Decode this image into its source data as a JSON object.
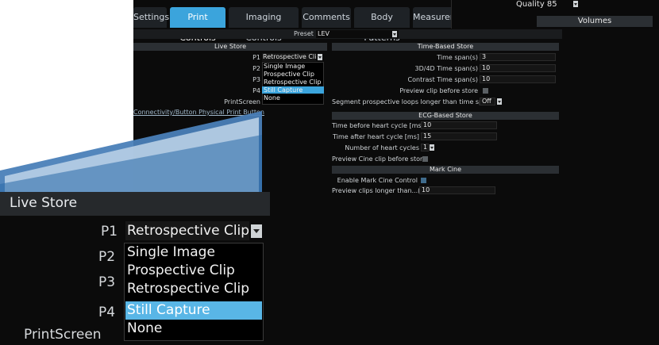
{
  "tabs": [
    {
      "label": "Settings"
    },
    {
      "label": "Print Controls"
    },
    {
      "label": "Imaging Controls"
    },
    {
      "label": "Comments"
    },
    {
      "label": "Body Patterns"
    },
    {
      "label": "Measurement"
    }
  ],
  "quality_panel": {
    "quality_label": "Quality 85",
    "volumes_label": "Volumes"
  },
  "preset": {
    "label": "Preset",
    "value": "LEV"
  },
  "live_store": {
    "title": "Live Store",
    "p1_label": "P1",
    "p1_value": "Retrospective Clip",
    "p2_label": "P2",
    "p3_label": "P3",
    "p4_label": "P4",
    "printscreen_label": "PrintScreen",
    "options": [
      "Single Image",
      "Prospective Clip",
      "Retrospective Clip",
      "Still Capture",
      "None"
    ],
    "selected_option": "Still Capture",
    "connectivity_link": "Connectivity/Button Physical Print Button"
  },
  "time_based_store": {
    "title": "Time-Based Store",
    "time_span_label": "Time span(s)",
    "time_span": "3",
    "time_span_3d_label": "3D/4D Time span(s)",
    "time_span_3d": "10",
    "contrast_label": "Contrast Time span(s)",
    "contrast": "10",
    "preview_label": "Preview clip before store",
    "segment_label": "Segment prospective loops longer than time span",
    "segment_value": "Off"
  },
  "ecg_based_store": {
    "title": "ECG-Based Store",
    "before_label": "Time before heart cycle [ms]",
    "before_value": "10",
    "after_label": "Time after heart cycle [ms]",
    "after_value": "15",
    "cycles_label": "Number of heart cycles",
    "cycles_value": "1",
    "preview_label": "Preview Cine clip before store"
  },
  "mark_cine": {
    "title": "Mark Cine",
    "enable_label": "Enable Mark Cine Control",
    "preview_label": "Preview clips longer than...(s)",
    "preview_value": "10"
  }
}
